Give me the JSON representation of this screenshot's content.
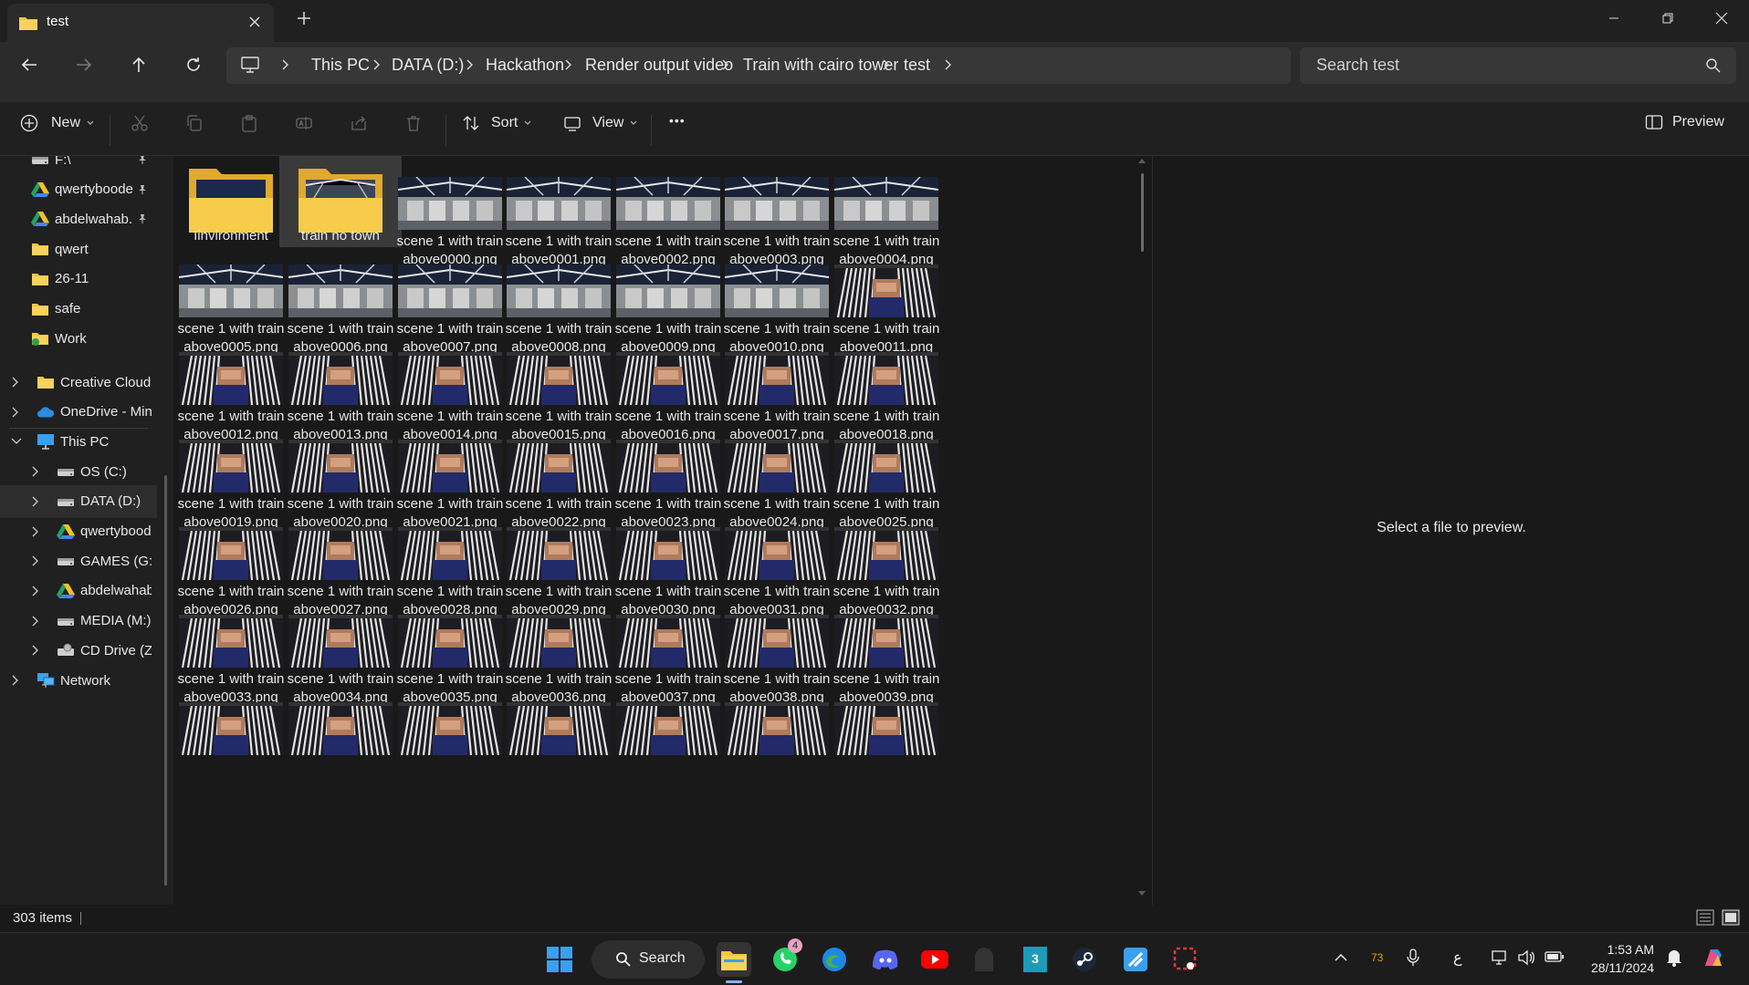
{
  "window": {
    "tab_title": "test",
    "min_label": "—",
    "colors": {
      "bg": "#191919",
      "chrome": "#202020",
      "bar": "#2b2b2b",
      "folder": "#f4c542"
    }
  },
  "nav": {
    "breadcrumbs": [
      "This PC",
      "DATA (D:)",
      "Hackathon",
      "Render output video",
      "Train with cairo tower",
      "test"
    ],
    "search_placeholder": "Search test"
  },
  "toolbar": {
    "new_label": "New",
    "sort_label": "Sort",
    "view_label": "View",
    "more_label": "•••",
    "preview_label": "Preview"
  },
  "sidebar": {
    "quick": [
      {
        "label": "F:\\",
        "icon": "drive-icon",
        "pinned": true
      },
      {
        "label": "qwertyboode",
        "icon": "google-drive-icon",
        "pinned": true
      },
      {
        "label": "abdelwahab.",
        "icon": "google-drive-icon",
        "pinned": true
      },
      {
        "label": "qwert",
        "icon": "folder-icon",
        "pinned": false
      },
      {
        "label": "26-11",
        "icon": "folder-icon",
        "pinned": false
      },
      {
        "label": "safe",
        "icon": "folder-icon",
        "pinned": false
      },
      {
        "label": "Work",
        "icon": "folder-sync-icon",
        "pinned": false
      }
    ],
    "tree": [
      {
        "label": "Creative Cloud F",
        "icon": "folder-icon",
        "indent": 0,
        "expanded": false
      },
      {
        "label": "OneDrive - Mini",
        "icon": "onedrive-icon",
        "indent": 0,
        "expanded": false
      },
      {
        "label": "This PC",
        "icon": "pc-icon",
        "indent": 0,
        "expanded": true
      },
      {
        "label": "OS (C:)",
        "icon": "drive-icon",
        "indent": 1,
        "expanded": false
      },
      {
        "label": "DATA (D:)",
        "icon": "drive-icon",
        "indent": 1,
        "expanded": false,
        "selected": true
      },
      {
        "label": "qwertyboode(",
        "icon": "google-drive-icon",
        "indent": 1,
        "expanded": false
      },
      {
        "label": "GAMES (G:)",
        "icon": "drive-icon",
        "indent": 1,
        "expanded": false
      },
      {
        "label": "abdelwahab.t\\",
        "icon": "google-drive-icon",
        "indent": 1,
        "expanded": false
      },
      {
        "label": "MEDIA (M:)",
        "icon": "drive-icon",
        "indent": 1,
        "expanded": false
      },
      {
        "label": "CD Drive (Z:)",
        "icon": "cd-drive-icon",
        "indent": 1,
        "expanded": false
      },
      {
        "label": "Network",
        "icon": "network-icon",
        "indent": 0,
        "expanded": false
      }
    ]
  },
  "content": {
    "items": [
      {
        "line1": "Iinvironment",
        "line2": "",
        "kind": "folder"
      },
      {
        "line1": "train no town",
        "line2": "",
        "kind": "folder",
        "selected": true
      },
      {
        "line1": "scene 1 with train",
        "line2": "above0000.png",
        "kind": "a"
      },
      {
        "line1": "scene 1 with train",
        "line2": "above0001.png",
        "kind": "a"
      },
      {
        "line1": "scene 1 with train",
        "line2": "above0002.png",
        "kind": "a"
      },
      {
        "line1": "scene 1 with train",
        "line2": "above0003.png",
        "kind": "a"
      },
      {
        "line1": "scene 1 with train",
        "line2": "above0004.png",
        "kind": "a"
      },
      {
        "line1": "scene 1 with train",
        "line2": "above0005.png",
        "kind": "a"
      },
      {
        "line1": "scene 1 with train",
        "line2": "above0006.png",
        "kind": "a"
      },
      {
        "line1": "scene 1 with train",
        "line2": "above0007.png",
        "kind": "a"
      },
      {
        "line1": "scene 1 with train",
        "line2": "above0008.png",
        "kind": "a"
      },
      {
        "line1": "scene 1 with train",
        "line2": "above0009.png",
        "kind": "a"
      },
      {
        "line1": "scene 1 with train",
        "line2": "above0010.png",
        "kind": "a"
      },
      {
        "line1": "scene 1 with train",
        "line2": "above0011.png",
        "kind": "b"
      },
      {
        "line1": "scene 1 with train",
        "line2": "above0012.png",
        "kind": "b"
      },
      {
        "line1": "scene 1 with train",
        "line2": "above0013.png",
        "kind": "b"
      },
      {
        "line1": "scene 1 with train",
        "line2": "above0014.png",
        "kind": "b"
      },
      {
        "line1": "scene 1 with train",
        "line2": "above0015.png",
        "kind": "b"
      },
      {
        "line1": "scene 1 with train",
        "line2": "above0016.png",
        "kind": "b"
      },
      {
        "line1": "scene 1 with train",
        "line2": "above0017.png",
        "kind": "b"
      },
      {
        "line1": "scene 1 with train",
        "line2": "above0018.png",
        "kind": "b"
      },
      {
        "line1": "scene 1 with train",
        "line2": "above0019.png",
        "kind": "b"
      },
      {
        "line1": "scene 1 with train",
        "line2": "above0020.png",
        "kind": "b"
      },
      {
        "line1": "scene 1 with train",
        "line2": "above0021.png",
        "kind": "b"
      },
      {
        "line1": "scene 1 with train",
        "line2": "above0022.png",
        "kind": "b"
      },
      {
        "line1": "scene 1 with train",
        "line2": "above0023.png",
        "kind": "b"
      },
      {
        "line1": "scene 1 with train",
        "line2": "above0024.png",
        "kind": "b"
      },
      {
        "line1": "scene 1 with train",
        "line2": "above0025.png",
        "kind": "b"
      },
      {
        "line1": "scene 1 with train",
        "line2": "above0026.png",
        "kind": "b"
      },
      {
        "line1": "scene 1 with train",
        "line2": "above0027.png",
        "kind": "b"
      },
      {
        "line1": "scene 1 with train",
        "line2": "above0028.png",
        "kind": "b"
      },
      {
        "line1": "scene 1 with train",
        "line2": "above0029.png",
        "kind": "b"
      },
      {
        "line1": "scene 1 with train",
        "line2": "above0030.png",
        "kind": "b"
      },
      {
        "line1": "scene 1 with train",
        "line2": "above0031.png",
        "kind": "b"
      },
      {
        "line1": "scene 1 with train",
        "line2": "above0032.png",
        "kind": "b"
      },
      {
        "line1": "scene 1 with train",
        "line2": "above0033.png",
        "kind": "b"
      },
      {
        "line1": "scene 1 with train",
        "line2": "above0034.png",
        "kind": "b"
      },
      {
        "line1": "scene 1 with train",
        "line2": "above0035.png",
        "kind": "b"
      },
      {
        "line1": "scene 1 with train",
        "line2": "above0036.png",
        "kind": "b"
      },
      {
        "line1": "scene 1 with train",
        "line2": "above0037.png",
        "kind": "b"
      },
      {
        "line1": "scene 1 with train",
        "line2": "above0038.png",
        "kind": "b"
      },
      {
        "line1": "scene 1 with train",
        "line2": "above0039.png",
        "kind": "b"
      },
      {
        "line1": "",
        "line2": "",
        "kind": "b"
      },
      {
        "line1": "",
        "line2": "",
        "kind": "b"
      },
      {
        "line1": "",
        "line2": "",
        "kind": "b"
      },
      {
        "line1": "",
        "line2": "",
        "kind": "b"
      },
      {
        "line1": "",
        "line2": "",
        "kind": "b"
      },
      {
        "line1": "",
        "line2": "",
        "kind": "b"
      },
      {
        "line1": "",
        "line2": "",
        "kind": "b"
      }
    ]
  },
  "preview": {
    "message": "Select a file to preview."
  },
  "status": {
    "item_count": "303 items"
  },
  "taskbar": {
    "search_label": "Search",
    "whatsapp_badge": "4",
    "temperature": "73",
    "ime_label": "ع",
    "time": "1:53 AM",
    "date": "28/11/2024"
  }
}
